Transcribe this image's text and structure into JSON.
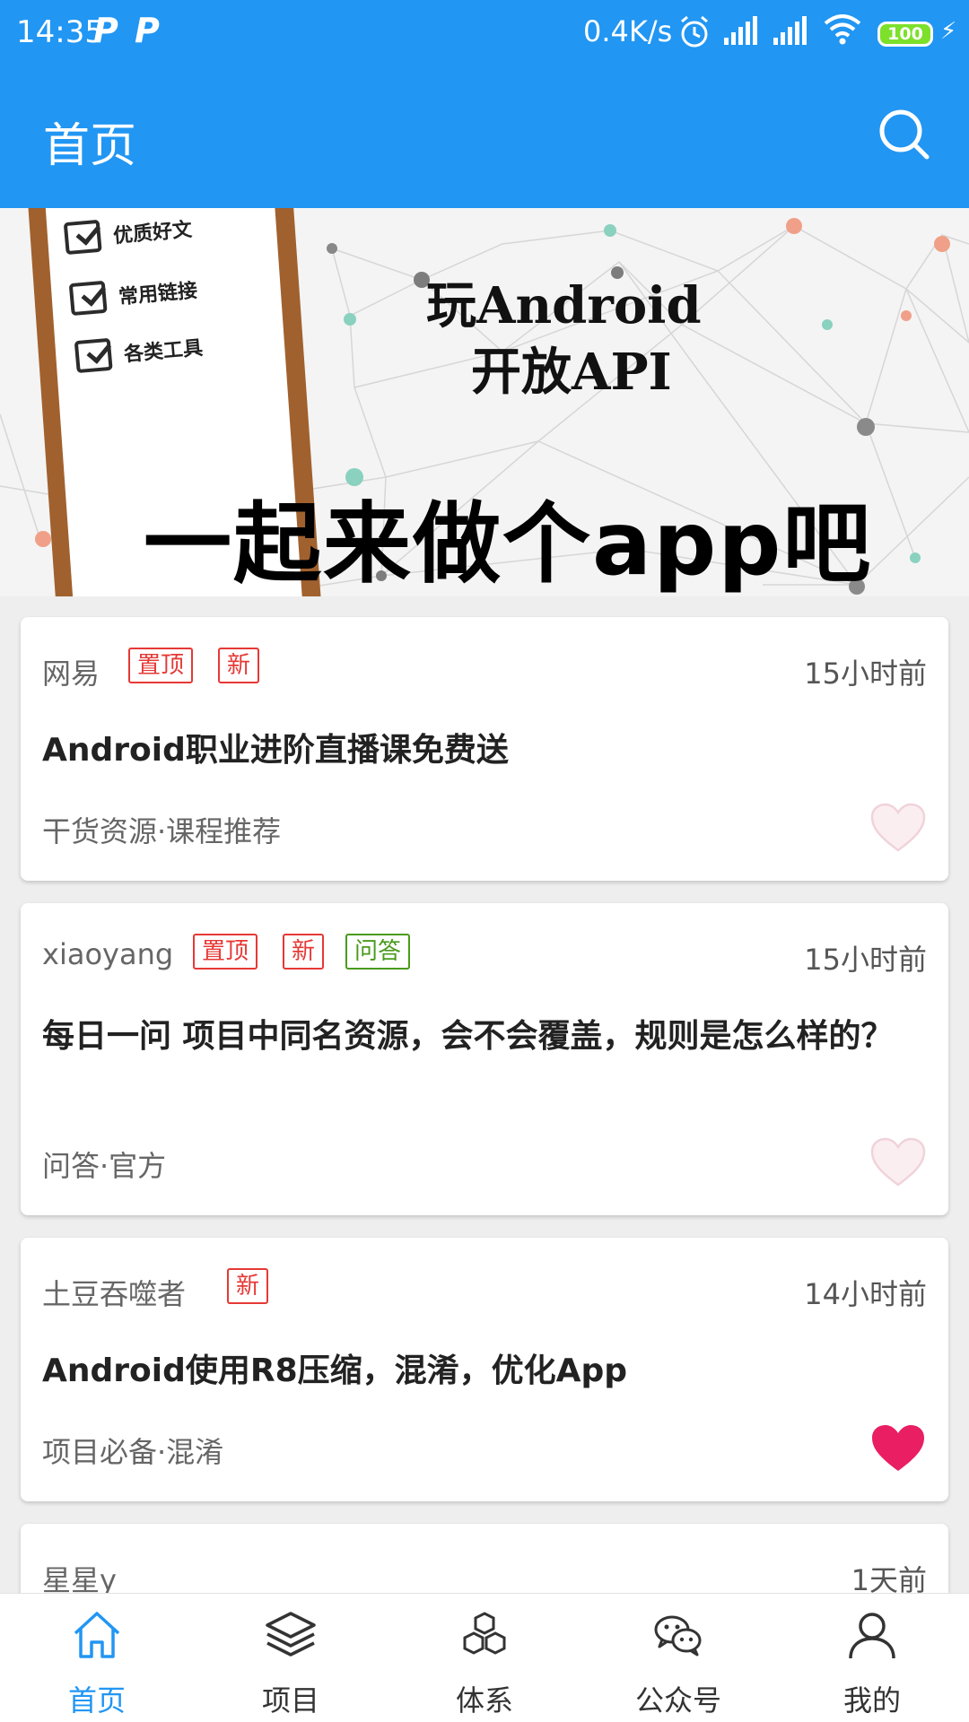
{
  "status_bar": {
    "time": "14:35",
    "p_icon_1": "P",
    "p_icon_2": "P",
    "net_speed": "0.4K/s",
    "battery": "100",
    "icons": [
      "alarm-icon",
      "signal-icon",
      "signal-icon",
      "wifi-icon",
      "battery-icon",
      "charging-icon"
    ]
  },
  "header": {
    "title": "首页",
    "search_icon": "search-icon"
  },
  "banner": {
    "checklist": [
      "优质好文",
      "常用链接",
      "各类工具"
    ],
    "title_line1": "玩Android",
    "title_line2": "开放API",
    "slogan": "一起来做个app吧"
  },
  "articles": [
    {
      "author": "网易",
      "tags": [
        "置顶",
        "新"
      ],
      "time": "15小时前",
      "title": "Android职业进阶直播课免费送",
      "chapter": "干货资源·课程推荐",
      "liked": false
    },
    {
      "author": "xiaoyang",
      "tags": [
        "置顶",
        "新",
        "问答"
      ],
      "time": "15小时前",
      "title": "每日一问 项目中同名资源，会不会覆盖，规则是怎么样的？",
      "chapter": "问答·官方",
      "liked": false
    },
    {
      "author": "土豆吞噬者",
      "tags": [
        "新"
      ],
      "time": "14小时前",
      "title": "Android使用R8压缩，混淆，优化App",
      "chapter": "项目必备·混淆",
      "liked": true
    },
    {
      "author": "星星y",
      "tags": [],
      "time": "1天前",
      "title": "",
      "chapter": "",
      "liked": false
    }
  ],
  "bottom_nav": [
    {
      "label": "首页",
      "icon": "home-icon",
      "active": true
    },
    {
      "label": "项目",
      "icon": "layers-icon",
      "active": false
    },
    {
      "label": "体系",
      "icon": "cubes-icon",
      "active": false
    },
    {
      "label": "公众号",
      "icon": "wechat-icon",
      "active": false
    },
    {
      "label": "我的",
      "icon": "user-icon",
      "active": false
    }
  ],
  "colors": {
    "primary": "#2196f3",
    "tag_red": "#e53935",
    "tag_green": "#4a9a1c",
    "heart_liked": "#e91e63",
    "heart_unliked": "#f4dde3"
  }
}
